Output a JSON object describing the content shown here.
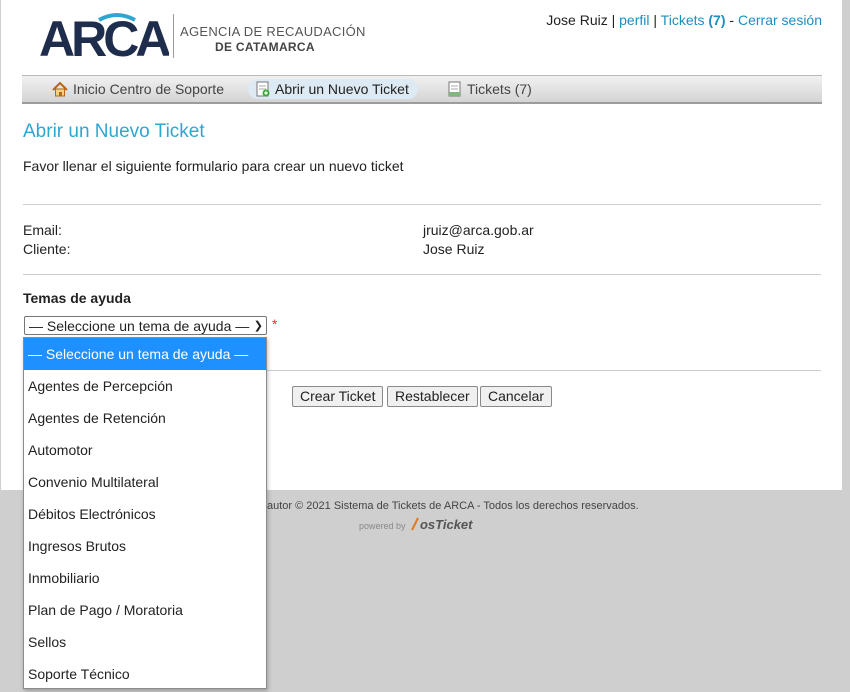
{
  "logo": {
    "mark": "ARCA",
    "line1": "AGENCIA DE RECAUDACIÓN",
    "line2": "DE CATAMARCA"
  },
  "user": {
    "name": "Jose Ruiz",
    "sep": " | ",
    "profile": "perfil",
    "tickets": "Tickets",
    "tickets_count": "(7)",
    "dash": " - ",
    "logout": "Cerrar sesión"
  },
  "nav": [
    {
      "label": "Inicio Centro de Soporte",
      "icon": "home-icon"
    },
    {
      "label": "Abrir un Nuevo Ticket",
      "icon": "new-ticket-icon"
    },
    {
      "label": "Tickets (7)",
      "icon": "tickets-icon"
    }
  ],
  "page": {
    "title": "Abrir un Nuevo Ticket",
    "intro": "Favor llenar el siguiente formulario para crear un nuevo ticket"
  },
  "client": {
    "email_label": "Email:",
    "email": "jruiz@arca.gob.ar",
    "client_label": "Cliente:",
    "client": "Jose Ruiz"
  },
  "topic": {
    "label": "Temas de ayuda",
    "selected": "— Seleccione un tema de ayuda —",
    "required": "*",
    "options": [
      "— Seleccione un tema de ayuda —",
      "Agentes de Percepción",
      "Agentes de Retención",
      "Automotor",
      "Convenio Multilateral",
      "Débitos Electrónicos",
      "Ingresos Brutos",
      "Inmobiliario",
      "Plan de Pago / Moratoria",
      "Sellos",
      "Soporte Técnico"
    ]
  },
  "buttons": {
    "create": "Crear Ticket",
    "reset": "Restablecer",
    "cancel": "Cancelar"
  },
  "footer": {
    "copyright": "autor © 2021 Sistema de Tickets de ARCA - Todos los derechos reservados.",
    "powered": "powered by",
    "brand": "osTicket"
  },
  "colors": {
    "link": "#1a8fc4",
    "title": "#2fa6d0",
    "selected_option": "#1e90ff",
    "logo_navy": "#1f2d4d"
  }
}
